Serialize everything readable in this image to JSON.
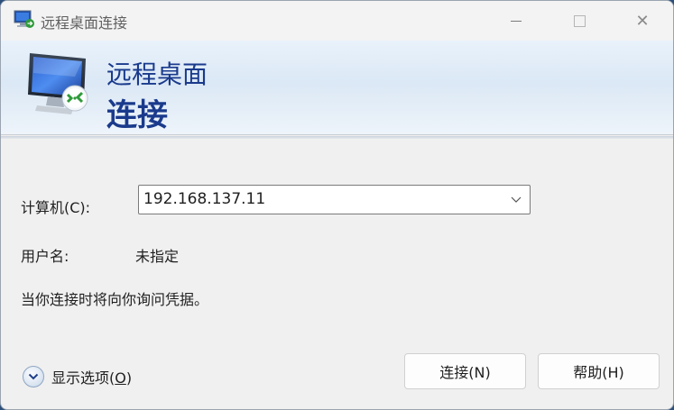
{
  "window": {
    "title": "远程桌面连接",
    "minimize_label": "",
    "maximize_label": "",
    "close_label": "✕"
  },
  "banner": {
    "line1": "远程桌面",
    "line2": "连接"
  },
  "form": {
    "computer_label": "计算机(C):",
    "computer_value": "192.168.137.11",
    "username_label": "用户名:",
    "username_value": "未指定",
    "credentials_note": "当你连接时将向你询问凭据。"
  },
  "footer": {
    "show_options_prefix": "显示选项(",
    "show_options_key": "O",
    "show_options_suffix": ")",
    "connect_label": "连接(N)",
    "help_label": "帮助(H)"
  },
  "colors": {
    "banner_text": "#1a3a8c",
    "window_bg": "#f0f0f0"
  },
  "icons": {
    "app": "remote-desktop-icon",
    "banner": "monitor-connect-icon",
    "dropdown": "chevron-down-icon",
    "options": "expand-circle-icon"
  }
}
